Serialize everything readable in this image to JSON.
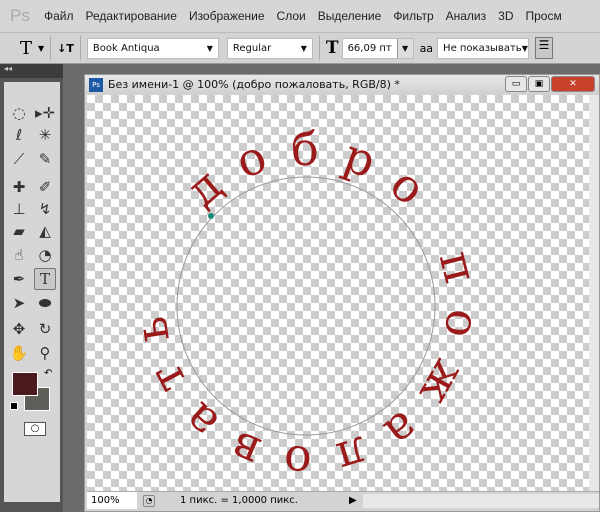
{
  "app": {
    "logo": "Ps"
  },
  "menu": [
    "Файл",
    "Редактирование",
    "Изображение",
    "Слои",
    "Выделение",
    "Фильтр",
    "Анализ",
    "3D",
    "Просм"
  ],
  "options": {
    "tool_icon": "T",
    "orientation_icon": "↓T",
    "font_family": "Book Antiqua",
    "font_style": "Regular",
    "size_icon": "T",
    "font_size": "66,09 пт",
    "aa_icon": "aa",
    "antialias": "Не показывать"
  },
  "tools": {
    "collapse": "◂◂",
    "icons": [
      "marquee",
      "move",
      "lasso",
      "magic-wand",
      "crop",
      "eyedropper",
      "healing",
      "brush",
      "stamp",
      "history-brush",
      "eraser",
      "paint-bucket",
      "blur",
      "dodge",
      "pen",
      "type",
      "path-select",
      "ellipse",
      "3d-rotate",
      "3d-orbit",
      "hand",
      "zoom"
    ],
    "foreground_color": "#4a1a1c",
    "background_color": "#5f5f5a"
  },
  "document": {
    "title": "Без имени-1 @ 100% (добро пожаловать, RGB/8) *",
    "text_on_path": "добро пожаловать",
    "text_color": "#9b1b1b"
  },
  "status": {
    "zoom": "100%",
    "info": "1 пикс. = 1,0000 пикс."
  }
}
